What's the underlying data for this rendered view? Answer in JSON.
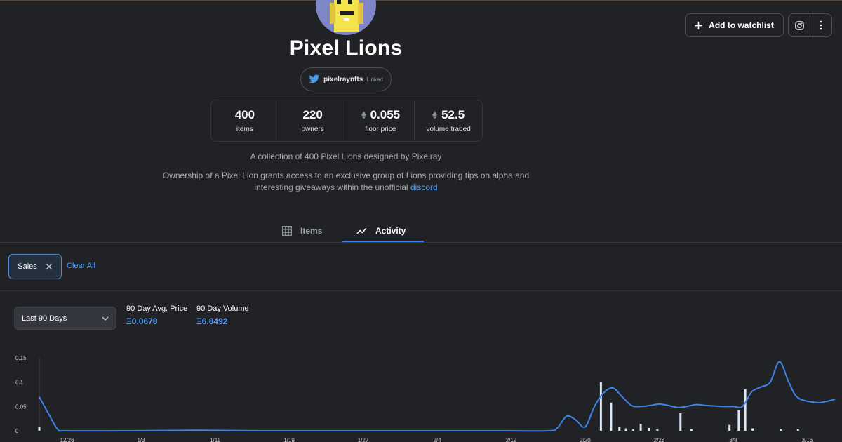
{
  "collection": {
    "name": "Pixel Lions",
    "twitter_handle": "pixelraynfts",
    "twitter_status": "Linked",
    "stats": [
      {
        "value": "400",
        "label": "items",
        "eth": false
      },
      {
        "value": "220",
        "label": "owners",
        "eth": false
      },
      {
        "value": "0.055",
        "label": "floor price",
        "eth": true
      },
      {
        "value": "52.5",
        "label": "volume traded",
        "eth": true
      }
    ],
    "description_line1": "A collection of 400 Pixel Lions designed by Pixelray",
    "description_line2": "Ownership of a Pixel Lion grants access to an exclusive group of Lions providing tips on alpha and interesting giveaways within the unofficial",
    "description_link": "discord"
  },
  "header_actions": {
    "watchlist_label": "Add to watchlist",
    "instagram_icon": "instagram-icon",
    "more_icon": "more-vertical-icon"
  },
  "tabs": [
    {
      "label": "Items",
      "icon": "grid-icon",
      "active": false
    },
    {
      "label": "Activity",
      "icon": "activity-line-icon",
      "active": true
    }
  ],
  "filters": {
    "chip_label": "Sales",
    "clear_label": "Clear All"
  },
  "stats_panel": {
    "range_selected": "Last 90 Days",
    "avg_price_label": "90 Day Avg. Price",
    "avg_price_value": "Ξ0.0678",
    "volume_label": "90 Day Volume",
    "volume_value": "Ξ6.8492"
  },
  "colors": {
    "accent": "#3e83e6",
    "link": "#5b9ef5",
    "background": "#202225",
    "bar": "#dbe7f5"
  },
  "chart_data": {
    "type": "line",
    "title": "",
    "xlabel": "",
    "ylabel": "",
    "ylim": [
      0,
      0.15
    ],
    "yticks": [
      "0.15",
      "0.1",
      "0.05",
      "0"
    ],
    "ytick_values": [
      0.15,
      0.1,
      0.05,
      0
    ],
    "xlim": [
      0,
      82
    ],
    "xticks": [
      {
        "day": 3,
        "label": "12/26"
      },
      {
        "day": 11,
        "label": "1/3"
      },
      {
        "day": 19,
        "label": "1/11"
      },
      {
        "day": 27,
        "label": "1/19"
      },
      {
        "day": 35,
        "label": "1/27"
      },
      {
        "day": 43,
        "label": "2/4"
      },
      {
        "day": 51,
        "label": "2/12"
      },
      {
        "day": 59,
        "label": "2/20"
      },
      {
        "day": 67,
        "label": "2/28"
      },
      {
        "day": 75,
        "label": "3/8"
      },
      {
        "day": 83,
        "label": "3/16"
      }
    ],
    "series": [
      {
        "kind": "line",
        "points": [
          [
            0,
            0.07
          ],
          [
            1,
            0.035
          ],
          [
            2,
            0.003
          ],
          [
            3,
            0
          ],
          [
            10,
            0
          ],
          [
            17,
            0.001
          ],
          [
            24,
            0
          ],
          [
            40,
            0
          ],
          [
            50,
            0
          ],
          [
            55,
            0
          ],
          [
            56,
            0.006
          ],
          [
            57,
            0.03
          ],
          [
            58,
            0.022
          ],
          [
            59,
            0.008
          ],
          [
            60,
            0.05
          ],
          [
            61,
            0.078
          ],
          [
            62,
            0.088
          ],
          [
            63,
            0.07
          ],
          [
            64,
            0.052
          ],
          [
            65,
            0.05
          ],
          [
            66,
            0.052
          ],
          [
            67,
            0.055
          ],
          [
            68,
            0.052
          ],
          [
            69,
            0.048
          ],
          [
            70,
            0.05
          ],
          [
            71,
            0.054
          ],
          [
            72,
            0.052
          ],
          [
            73,
            0.051
          ],
          [
            74,
            0.05
          ],
          [
            75,
            0.05
          ],
          [
            76,
            0.05
          ],
          [
            77,
            0.08
          ],
          [
            78,
            0.09
          ],
          [
            79,
            0.1
          ],
          [
            80,
            0.142
          ],
          [
            81,
            0.1
          ],
          [
            82,
            0.068
          ],
          [
            84,
            0.058
          ],
          [
            85,
            0.06
          ],
          [
            86,
            0.065
          ]
        ]
      },
      {
        "kind": "bar",
        "points": [
          [
            0,
            0.008
          ],
          [
            60.7,
            0.1
          ],
          [
            61.8,
            0.058
          ],
          [
            62.7,
            0.008
          ],
          [
            63.4,
            0.005
          ],
          [
            64.2,
            0.003
          ],
          [
            65.0,
            0.014
          ],
          [
            65.9,
            0.006
          ],
          [
            66.8,
            0.003
          ],
          [
            69.3,
            0.036
          ],
          [
            70.5,
            0.003
          ],
          [
            74.6,
            0.012
          ],
          [
            75.6,
            0.042
          ],
          [
            76.3,
            0.085
          ],
          [
            77.1,
            0.005
          ],
          [
            80.2,
            0.003
          ],
          [
            82.0,
            0.004
          ]
        ]
      }
    ]
  }
}
